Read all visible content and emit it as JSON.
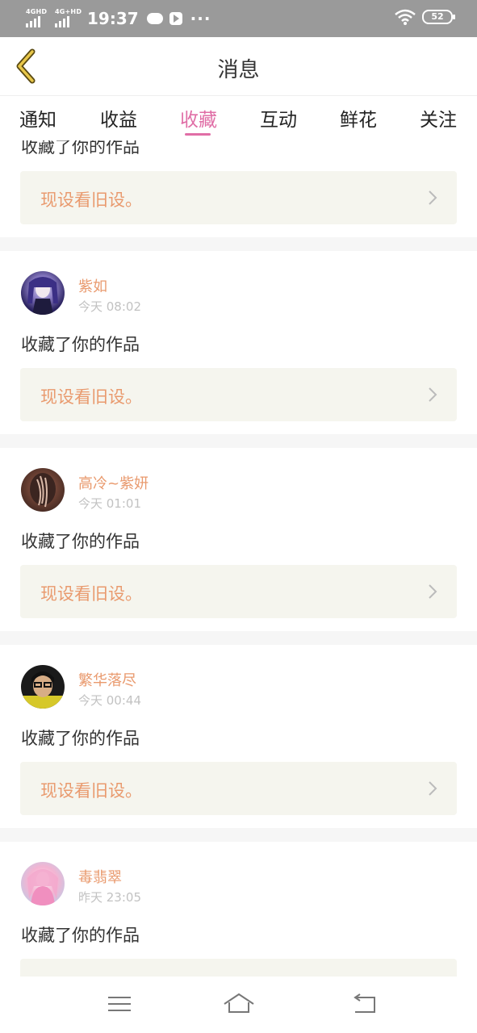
{
  "status_bar": {
    "signal1_label": "4GHD",
    "signal2_label": "4G+HD",
    "time": "19:37",
    "dots": "···",
    "battery": "52"
  },
  "header": {
    "title": "消息"
  },
  "tabs": [
    {
      "label": "通知"
    },
    {
      "label": "收益"
    },
    {
      "label": "收藏",
      "active": true
    },
    {
      "label": "互动"
    },
    {
      "label": "鲜花"
    },
    {
      "label": "关注"
    }
  ],
  "first_card": {
    "action": "收藏了你的作品",
    "quote": "现设看旧设。"
  },
  "messages": [
    {
      "name": "紫如",
      "time": "今天 08:02",
      "action": "收藏了你的作品",
      "quote": "现设看旧设。"
    },
    {
      "name": "高冷~紫妍",
      "time": "今天 01:01",
      "action": "收藏了你的作品",
      "quote": "现设看旧设。"
    },
    {
      "name": "繁华落尽",
      "time": "今天 00:44",
      "action": "收藏了你的作品",
      "quote": "现设看旧设。"
    },
    {
      "name": "毒翡翠",
      "time": "昨天 23:05",
      "action": "收藏了你的作品",
      "quote": ""
    }
  ],
  "colors": {
    "accent": "#e06ea6",
    "name": "#e99a6e",
    "quote_bg": "#f5f5ee"
  }
}
